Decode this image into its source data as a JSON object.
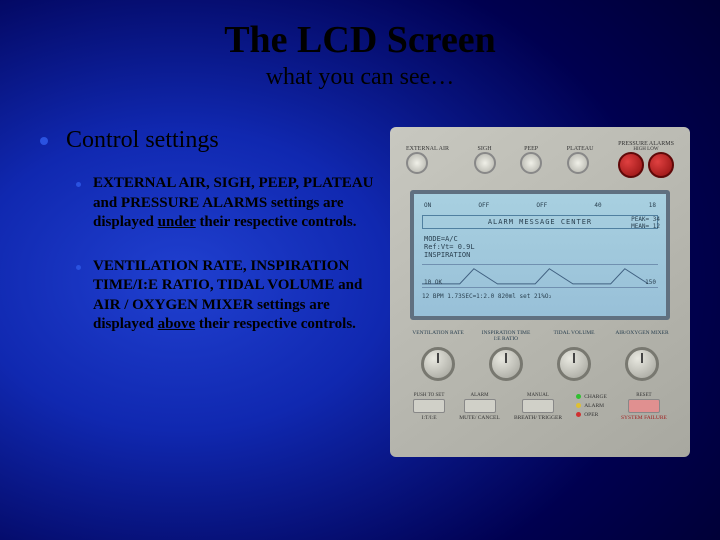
{
  "title": "The LCD Screen",
  "subtitle": "what you can see…",
  "main_bullet": "Control settings",
  "sub1_pre": "EXTERNAL AIR, SIGH, PEEP, PLATEAU and PRESSURE ALARMS settings are displayed ",
  "sub1_u": "under",
  "sub1_post": " their respective controls.",
  "sub2_pre": "VENTILATION RATE, INSPIRATION TIME/I:E RATIO, TIDAL VOLUME and AIR / OXYGEN MIXER settings are displayed ",
  "sub2_u": "above",
  "sub2_post": " their respective controls.",
  "device": {
    "top_labels": [
      "EXTERNAL AIR",
      "SIGH",
      "PEEP",
      "PLATEAU",
      "PRESSURE ALARMS"
    ],
    "pressure_sub": "HIGH    LOW",
    "lcd": {
      "top_values": [
        "ON",
        "OFF",
        "OFF",
        "40",
        "18"
      ],
      "alarm_center": "ALARM MESSAGE CENTER",
      "peak": "PEAK= 34",
      "mean": "MEAN= 12",
      "mode": "MODE=A/C",
      "rate": "Ref:Vt= 0.9L",
      "insp": "INSPIRATION",
      "bar_l": "10   OK",
      "bar_r": "150",
      "bottom": "12 BPM  1.73SEC=1:2.0  820ml set  21%O₂"
    },
    "dials": [
      "VENTILATION RATE",
      "INSPIRATION TIME I:E RATIO",
      "TIDAL VOLUME",
      "AIR/OXYGEN MIXER"
    ],
    "buttons": {
      "b1": "MUTE/ CANCEL",
      "b1_top": "ALARM",
      "b2": "BREATH/ TRIGGER",
      "b2_top": "MANUAL",
      "b3": "SYSTEM FAILURE",
      "b3_top": "RESET",
      "b4": "I:T/I:E",
      "b4_top": "PUSH TO SET"
    },
    "leds": {
      "l1": "CHARGE",
      "l2": "ALARM",
      "l3": "OPER"
    }
  }
}
